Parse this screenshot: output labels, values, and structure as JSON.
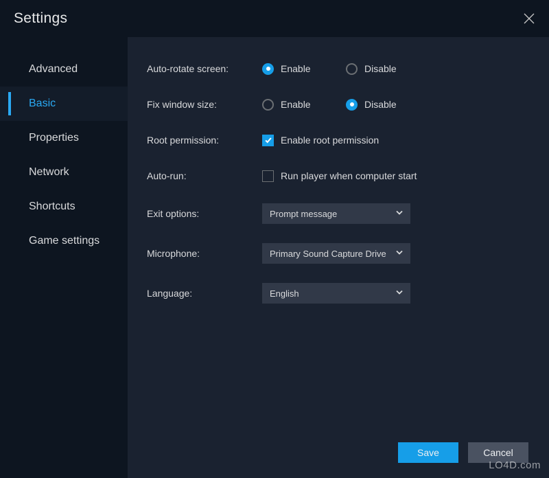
{
  "header": {
    "title": "Settings"
  },
  "sidebar": {
    "items": [
      {
        "label": "Advanced",
        "active": false
      },
      {
        "label": "Basic",
        "active": true
      },
      {
        "label": "Properties",
        "active": false
      },
      {
        "label": "Network",
        "active": false
      },
      {
        "label": "Shortcuts",
        "active": false
      },
      {
        "label": "Game settings",
        "active": false
      }
    ]
  },
  "settings": {
    "auto_rotate": {
      "label": "Auto-rotate screen:",
      "enable": "Enable",
      "disable": "Disable",
      "value": "enable"
    },
    "fix_window": {
      "label": "Fix window size:",
      "enable": "Enable",
      "disable": "Disable",
      "value": "disable"
    },
    "root_permission": {
      "label": "Root permission:",
      "checkbox_label": "Enable root permission",
      "checked": true
    },
    "auto_run": {
      "label": "Auto-run:",
      "checkbox_label": "Run player when computer start",
      "checked": false
    },
    "exit_options": {
      "label": "Exit options:",
      "value": "Prompt message"
    },
    "microphone": {
      "label": "Microphone:",
      "value": "Primary Sound Capture Drive"
    },
    "language": {
      "label": "Language:",
      "value": "English"
    }
  },
  "footer": {
    "save": "Save",
    "cancel": "Cancel"
  },
  "watermark": "LO4D.com",
  "colors": {
    "accent": "#169ee8",
    "bg_window": "#0d1520",
    "bg_panel": "#1a2230",
    "bg_select": "#313948"
  }
}
